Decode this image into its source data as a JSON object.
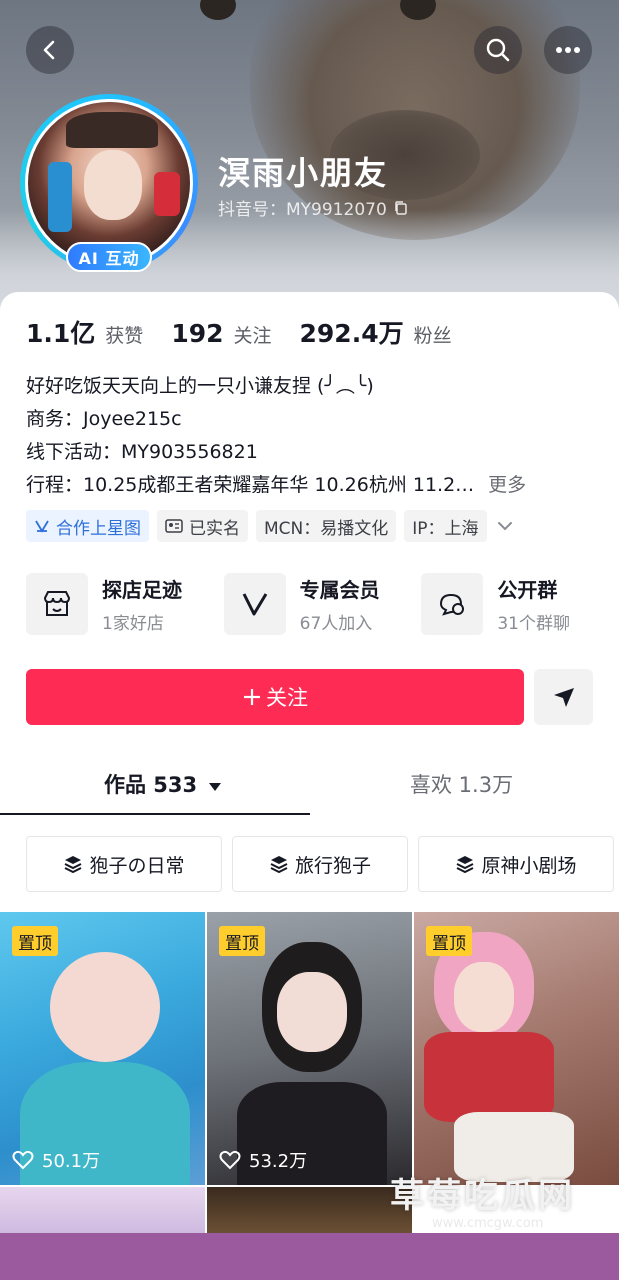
{
  "profile": {
    "nickname": "溟雨小朋友",
    "douyin_id": "抖音号：MY9912070",
    "ai_badge": "AI 互动"
  },
  "stats": [
    {
      "value": "1.1亿",
      "label": "获赞"
    },
    {
      "value": "192",
      "label": "关注"
    },
    {
      "value": "292.4万",
      "label": "粉丝"
    }
  ],
  "bio": {
    "line1": "好好吃饭天天向上的一只小谦友捏 (╯︵╰)",
    "line2": "商务：Joyee215c",
    "line3": "线下活动：MY903556821",
    "line4": "行程：10.25成都王者荣耀嘉年华 10.26杭州 11.2…",
    "more": "更多"
  },
  "tags": {
    "coop": "合作上星图",
    "verified": "已实名",
    "mcn": "MCN：易播文化",
    "ip": "IP：上海"
  },
  "services": [
    {
      "title": "探店足迹",
      "sub": "1家好店",
      "icon": "store-icon"
    },
    {
      "title": "专属会员",
      "sub": "67人加入",
      "icon": "vip-icon"
    },
    {
      "title": "公开群",
      "sub": "31个群聊",
      "icon": "group-chat-icon"
    }
  ],
  "actions": {
    "follow": "关注",
    "share_icon": "send-icon"
  },
  "tabs": {
    "works": "作品 533",
    "likes": "喜欢 1.3万"
  },
  "collections": [
    "狍子の日常",
    "旅行狍子",
    "原神小剧场"
  ],
  "videos": [
    {
      "pin": "置顶",
      "likes": "50.1万"
    },
    {
      "pin": "置顶",
      "likes": "53.2万"
    },
    {
      "pin": "置顶"
    }
  ],
  "watermark": {
    "text": "草莓吃瓜网",
    "url": "www.cmcgw.com"
  },
  "colors": {
    "accent": "#fe2c55",
    "pin": "#ffce2d",
    "ai_badge": "#2f7bff",
    "bottom_bar": "#9c5a9e"
  }
}
